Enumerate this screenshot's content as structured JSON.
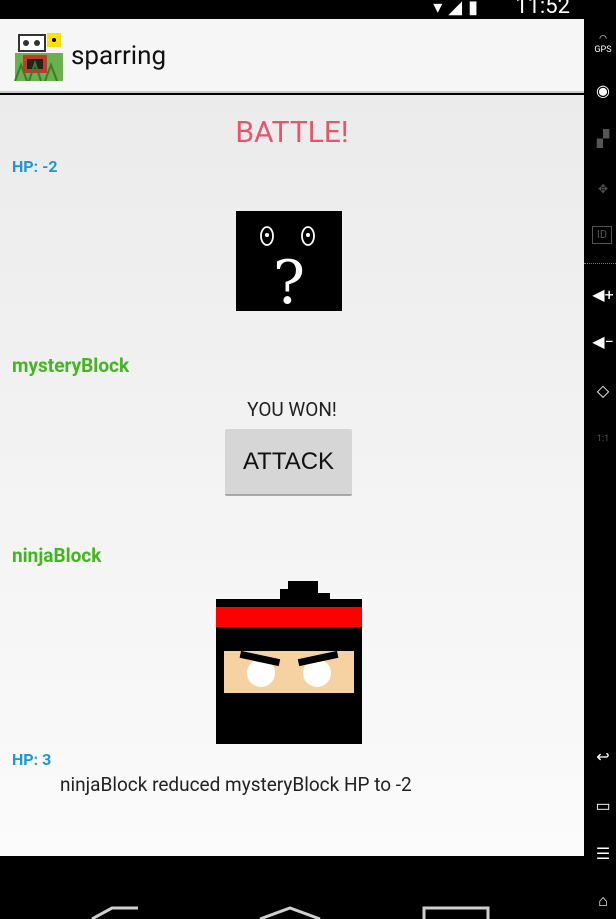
{
  "status_bar": {
    "time": "11:52"
  },
  "app": {
    "title": "sparring"
  },
  "battle": {
    "title": "BATTLE!",
    "enemy": {
      "hp_label": "HP: -2",
      "name": "mysteryBlock"
    },
    "player": {
      "hp_label": "HP: 3",
      "name": "ninjaBlock"
    },
    "result_text": "YOU WON!",
    "attack_label": "ATTACK",
    "log": "ninjaBlock reduced mysteryBlock HP to -2"
  },
  "side_toolbar": {
    "items": [
      "gps-icon",
      "webcam-icon",
      "clapperboard-icon",
      "dpad-icon",
      "id-icon",
      "volume-up-icon",
      "volume-down-icon",
      "rotate-icon",
      "scale-icon",
      "back-icon",
      "menu-icon",
      "recent-apps-icon",
      "home-icon"
    ]
  },
  "nav_bar": {
    "items": [
      "back-icon",
      "home-icon",
      "recent-apps-icon"
    ]
  },
  "colors": {
    "battle_title": "#e8546b",
    "hp": "#1a96e6",
    "block_name": "#42b61f",
    "headband": "#ff0000",
    "skin": "#f6d2a2"
  }
}
